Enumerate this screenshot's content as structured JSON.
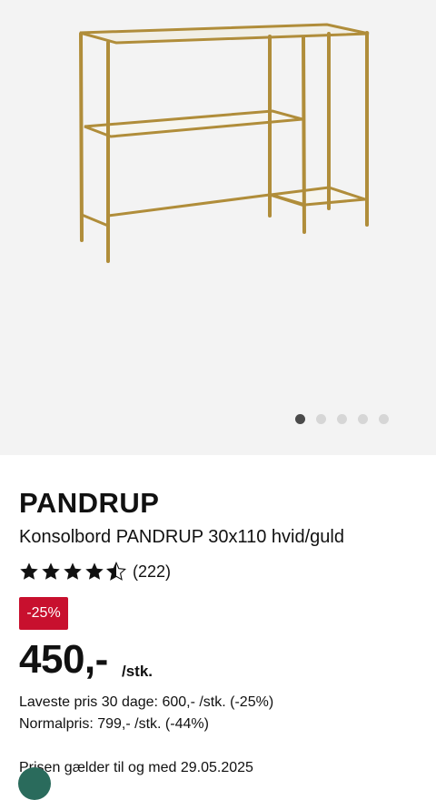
{
  "gallery": {
    "image_icon": "console-table-image",
    "slides": 5,
    "active_slide": 1
  },
  "product": {
    "brand": "PANDRUP",
    "description": "Konsolbord PANDRUP 30x110 hvid/guld",
    "rating": 4.5,
    "review_count": "(222)",
    "discount_badge": "-25%",
    "price": "450,-",
    "unit": "/stk.",
    "lowest_price": "Laveste pris 30 dage: 600,- /stk. (-25%)",
    "normal_price": "Normalpris: 799,- /stk. (-44%)",
    "validity": "Prisen gælder til og med 29.05.2025"
  },
  "colors": {
    "badge": "#c8102e",
    "gold": "#b08d3a",
    "chat": "#2a6b5c"
  }
}
